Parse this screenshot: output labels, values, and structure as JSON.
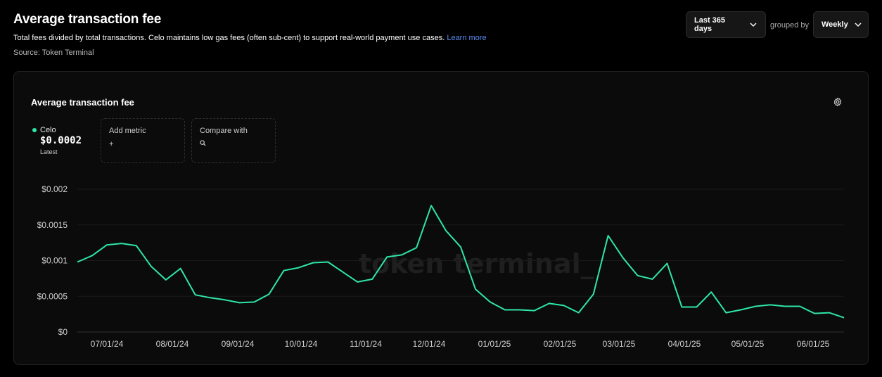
{
  "header": {
    "title": "Average transaction fee",
    "description": "Total fees divided by total transactions. Celo maintains low gas fees (often sub-cent) to support real-world payment use cases.",
    "learn_more": "Learn more",
    "source": "Source: Token Terminal"
  },
  "controls": {
    "range_label": "Last 365 days",
    "grouped_by_label": "grouped by",
    "group_label": "Weekly"
  },
  "card": {
    "title": "Average transaction fee",
    "legend": {
      "name": "Celo",
      "value": "$0.0002",
      "sub": "Latest"
    },
    "add_metric": {
      "label": "Add metric",
      "icon_text": "+"
    },
    "compare": {
      "label": "Compare with"
    },
    "watermark": "token terminal_"
  },
  "colors": {
    "line": "#2ee6a6",
    "accent_link": "#5b8def",
    "background": "#000000",
    "card": "#0b0b0b"
  },
  "chart_data": {
    "type": "line",
    "title": "Average transaction fee",
    "ylim": [
      0,
      0.002
    ],
    "y_ticks": [
      "$0",
      "$0.0005",
      "$0.001",
      "$0.0015",
      "$0.002"
    ],
    "x_ticks": [
      "07/01/24",
      "08/01/24",
      "09/01/24",
      "10/01/24",
      "11/01/24",
      "12/01/24",
      "01/01/25",
      "02/01/25",
      "03/01/25",
      "04/01/25",
      "05/01/25",
      "06/01/25"
    ],
    "grid": true,
    "series": [
      {
        "name": "Celo",
        "color": "#2ee6a6",
        "values": [
          0.00098,
          0.00107,
          0.00122,
          0.00124,
          0.00121,
          0.00092,
          0.00073,
          0.00089,
          0.00052,
          0.00048,
          0.00045,
          0.00041,
          0.00042,
          0.00053,
          0.00086,
          0.0009,
          0.00097,
          0.00098,
          0.00084,
          0.0007,
          0.00074,
          0.00105,
          0.00108,
          0.00118,
          0.00177,
          0.00142,
          0.00119,
          0.0006,
          0.00042,
          0.00031,
          0.00031,
          0.0003,
          0.0004,
          0.00037,
          0.00027,
          0.00053,
          0.00135,
          0.00104,
          0.00079,
          0.00074,
          0.00096,
          0.00035,
          0.00035,
          0.00056,
          0.00027,
          0.00031,
          0.00036,
          0.00038,
          0.00036,
          0.00036,
          0.00026,
          0.00027,
          0.0002
        ]
      }
    ]
  }
}
